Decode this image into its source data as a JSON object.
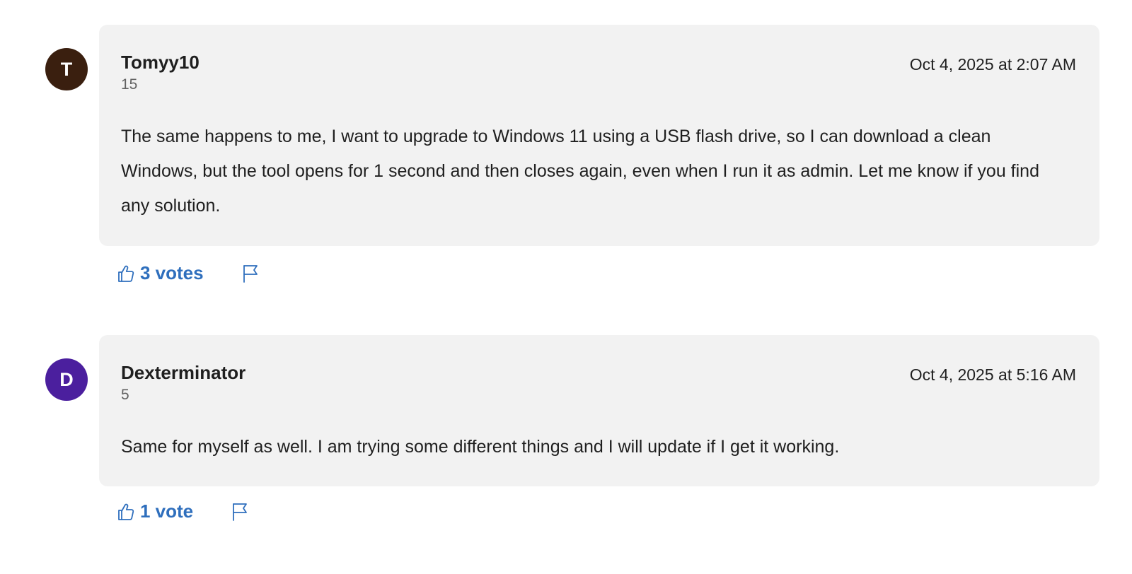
{
  "comments": [
    {
      "avatar_initial": "T",
      "avatar_color": "#3a1f0f",
      "author": "Tomyy10",
      "reputation": "15",
      "timestamp": "Oct 4, 2025 at 2:07 AM",
      "body": "The same happens to me, I want to upgrade to Windows 11 using a USB flash drive, so I can download a clean Windows, but the tool opens for 1 second and then closes again, even when I run it as admin. Let me know if you find any solution.",
      "votes_label": "3 votes",
      "vote_icon": "thumbs-up-icon",
      "flag_icon": "flag-icon"
    },
    {
      "avatar_initial": "D",
      "avatar_color": "#4b1f9e",
      "author": "Dexterminator",
      "reputation": "5",
      "timestamp": "Oct 4, 2025 at 5:16 AM",
      "body": "Same for myself as well. I am trying some different things and I will update if I get it working.",
      "votes_label": "1 vote",
      "vote_icon": "thumbs-up-icon",
      "flag_icon": "flag-icon"
    }
  ],
  "colors": {
    "card_background": "#f2f2f2",
    "link_blue": "#2f6fbd",
    "muted_text": "#616161"
  }
}
